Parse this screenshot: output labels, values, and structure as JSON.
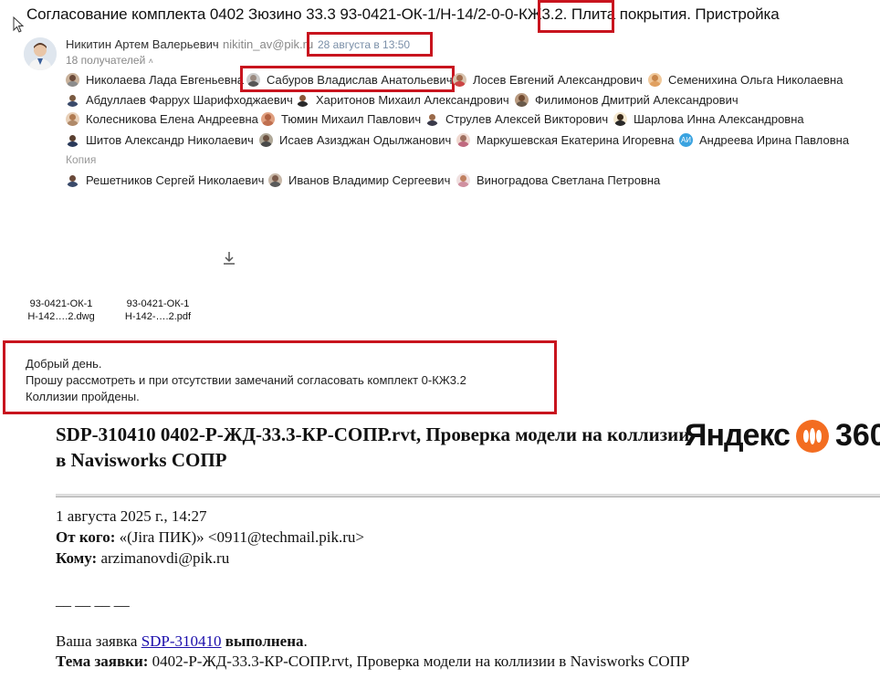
{
  "email": {
    "subject": "Согласование комплекта 0402 Зюзино 33.3 93-0421-ОК-1/Н-14/2-0-0-КЖ3.2. Плита покрытия. Пристройка",
    "sender_name": "Никитин Артем Валерьевич",
    "sender_email": "nikitin_av@pik.ru",
    "date": "28 августа в 13:50",
    "recipients_count": "18 получателей",
    "recipients": [
      {
        "name": "Николаева Лада Евгеньевна"
      },
      {
        "name": "Сабуров Владислав Анатольевич"
      },
      {
        "name": "Лосев Евгений Александрович"
      },
      {
        "name": "Семенихина Ольга Николаевна"
      },
      {
        "name": "Абдуллаев Фаррух Шарифходжаевич"
      },
      {
        "name": "Харитонов Михаил Александрович"
      },
      {
        "name": "Филимонов Дмитрий Александрович"
      },
      {
        "name": "Колесникова Елена Андреевна"
      },
      {
        "name": "Тюмин Михаил Павлович"
      },
      {
        "name": "Струлев Алексей Викторович"
      },
      {
        "name": "Шарлова Инна Александровна"
      },
      {
        "name": "Шитов Александр Николаевич"
      },
      {
        "name": "Исаев Азизджан Одылжанович"
      },
      {
        "name": "Маркушевская Екатерина Игоревна"
      },
      {
        "name": "Андреева Ирина Павловна",
        "initials": "АИ"
      }
    ],
    "copy_label": "Копия",
    "cc": [
      {
        "name": "Решетников Сергей Николаевич"
      },
      {
        "name": "Иванов Владимир Сергеевич"
      },
      {
        "name": "Виноградова Светлана Петровна"
      }
    ],
    "attachments": [
      {
        "line1": "93-0421-ОК-1",
        "line2": "Н-142….2.dwg"
      },
      {
        "line1": "93-0421-ОК-1",
        "line2": "Н-142-….2.pdf"
      }
    ],
    "body": [
      "Добрый день.",
      "Прошу рассмотреть и при отсутствии замечаний согласовать комплект 0-КЖ3.2",
      "Коллизии пройдены."
    ]
  },
  "forwarded": {
    "title": "SDP-310410 0402-Р-ЖД-33.3-КР-СОПР.rvt, Проверка модели на коллизии в Navisworks СОПР",
    "logo_text": "Яндекс",
    "logo_number": "360",
    "date_line": "1 августа 2025 г., 14:27",
    "from_label": "От кого:",
    "from_value": "«(Jira ПИК)» <0911@techmail.pik.ru>",
    "to_label": "Кому:",
    "to_value": "arzimanovdi@pik.ru",
    "separator": "__ __ __ __",
    "request_prefix": "Ваша заявка ",
    "request_link": "SDP-310410",
    "request_status": " выполнена",
    "request_end": ".",
    "topic_label": "Тема заявки:",
    "topic_value": " 0402-Р-ЖД-33.3-КР-СОПР.rvt, Проверка модели на коллизии в Navisworks СОПР"
  },
  "colors": {
    "highlight": "#c8141e",
    "logo_accent": "#f36d21",
    "link": "#1a0dab"
  }
}
